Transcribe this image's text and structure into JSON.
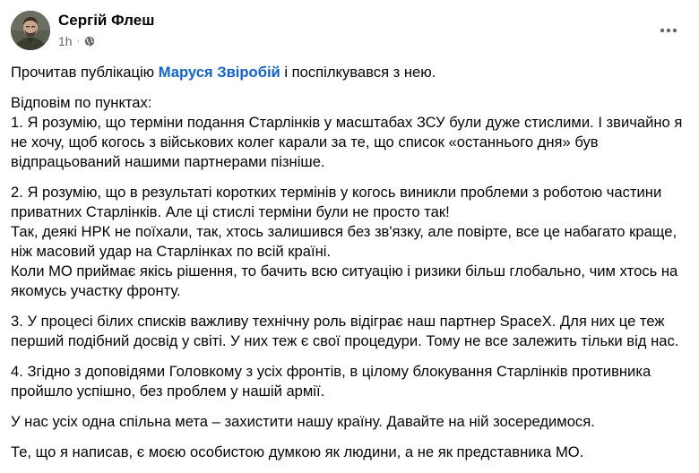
{
  "author": {
    "name": "Сергій Флеш",
    "time": "1h",
    "separator": "·",
    "privacy_icon": "globe-icon"
  },
  "header": {
    "more_icon": "more-options-icon"
  },
  "post": {
    "intro_before": "Прочитав публікацію ",
    "mention": "Маруся Звіробій",
    "intro_after": " і поспілкувався з нею.",
    "p1": "Відповім по пунктах:\n1. Я розумію, що терміни подання Старлінків у масштабах ЗСУ були дуже стислими. І звичайно я не хочу, щоб когось з військових колег карали за те, що список «останнього дня» був відпрацьований нашими партнерами пізніше.",
    "p2": "2. Я розумію, що в результаті коротких термінів у когось виникли проблеми з роботою частини приватних Старлінків. Але ці стислі терміни були не просто так!\nТак, деякі НРК не поїхали, так, хтось залишився без зв'язку, але повірте, все це набагато краще, ніж масовий удар на Старлінках по всій країні.\nКоли МО приймає якісь рішення, то бачить всю ситуацію і ризики більш глобально, чим хтось на якомусь участку фронту.",
    "p3": "3. У процесі білих списків важливу технічну роль відіграє наш партнер SpaceX. Для них це теж перший подібний досвід у світі. У них теж є свої процедури. Тому не все залежить тільки від нас.",
    "p4": "4. Згідно з доповідями Головкому з усіх фронтів, в цілому блокування Старлінків противника пройшло успішно, без проблем у нашій армії.",
    "p5": " У нас усіх одна спільна мета – захистити нашу країну. Давайте на ній зосередимося.",
    "p6": "Те, що я написав, є моєю особистою думкою як людини, а не як представника МО."
  },
  "colors": {
    "mention": "#1263c9",
    "meta": "#65676b",
    "text": "#050505"
  }
}
